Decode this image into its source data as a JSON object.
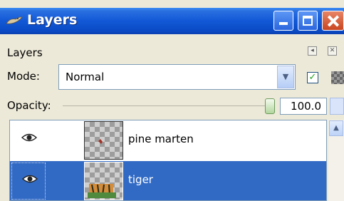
{
  "window": {
    "title": "Layers"
  },
  "panel": {
    "header": "Layers",
    "mode_label": "Mode:",
    "mode_value": "Normal",
    "opacity_label": "Opacity:",
    "opacity_value": "100.0",
    "opacity_level": 1.0,
    "lock_checked": true
  },
  "layers": [
    {
      "name": "pine marten",
      "visible": true,
      "selected": false
    },
    {
      "name": "tiger",
      "visible": true,
      "selected": true
    }
  ],
  "colors": {
    "titlebar": "#0a4ac4",
    "selection": "#316ac5",
    "face": "#ece9d8"
  }
}
